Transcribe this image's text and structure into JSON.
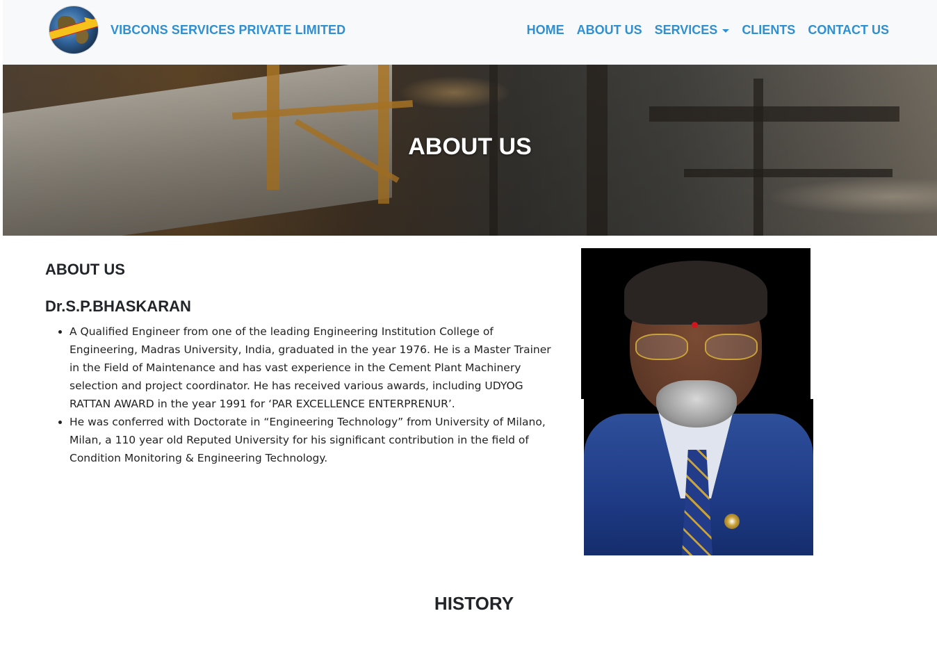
{
  "header": {
    "logo_name": "vibcons-globe-logo",
    "brand": "VIBCONS SERVICES PRIVATE LIMITED",
    "nav": [
      {
        "label": "HOME"
      },
      {
        "label": "ABOUT US"
      },
      {
        "label": "SERVICES",
        "dropdown": true
      },
      {
        "label": "CLIENTS"
      },
      {
        "label": "CONTACT US"
      }
    ],
    "link_color": "#2f8fd0"
  },
  "hero": {
    "title": "ABOUT US"
  },
  "about": {
    "heading": "ABOUT US",
    "name": "Dr.S.P.BHASKARAN",
    "bullets": [
      "A Qualified Engineer from one of the leading Engineering Institution College of Engineering, Madras University, India, graduated in the year 1976. He is a Master Trainer in the Field of Maintenance and has vast experience in the Cement Plant Machinery selection and project coordinator. He has received various awards, including UDYOG RATTAN AWARD in the year 1991 for ‘PAR EXCELLENCE ENTERPRENUR’.",
      "He was conferred with Doctorate in “Engineering Technology” from University of Milano, Milan, a 110 year old Reputed University for his significant contribution in the field of Condition Monitoring & Engineering Technology."
    ]
  },
  "history": {
    "heading": "HISTORY"
  }
}
